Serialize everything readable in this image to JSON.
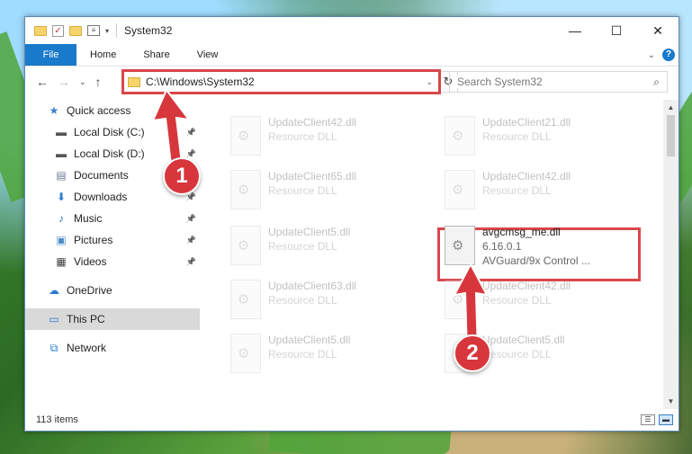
{
  "window": {
    "title": "System32",
    "controls": {
      "minimize": "—",
      "maximize": "☐",
      "close": "✕"
    }
  },
  "quick_access_toolbar": {
    "dropdown": "▾"
  },
  "ribbon": {
    "tabs": [
      "File",
      "Home",
      "Share",
      "View"
    ],
    "expand": "⌄",
    "help": "?"
  },
  "navigation": {
    "back": "←",
    "forward": "→",
    "recent": "⌄",
    "up": "↑"
  },
  "address": {
    "path": "C:\\Windows\\System32",
    "dropdown": "⌄",
    "refresh": "↻"
  },
  "search": {
    "placeholder": "Search System32",
    "icon": "⌕"
  },
  "nav_pane": {
    "items": [
      {
        "label": "Quick access",
        "icon": "star-icon",
        "glyph": "★",
        "color": "#3b7fd1",
        "level": 0,
        "pinned": false
      },
      {
        "label": "Local Disk (C:)",
        "icon": "drive-icon",
        "glyph": "▬",
        "color": "#555555",
        "level": 1,
        "pinned": true
      },
      {
        "label": "Local Disk (D:)",
        "icon": "drive-icon",
        "glyph": "▬",
        "color": "#555555",
        "level": 1,
        "pinned": true
      },
      {
        "label": "Documents",
        "icon": "documents-icon",
        "glyph": "▤",
        "color": "#6b7c93",
        "level": 1,
        "pinned": true
      },
      {
        "label": "Downloads",
        "icon": "download-icon",
        "glyph": "⬇",
        "color": "#2a7ad0",
        "level": 1,
        "pinned": true
      },
      {
        "label": "Music",
        "icon": "music-icon",
        "glyph": "♪",
        "color": "#2a7ad0",
        "level": 1,
        "pinned": true
      },
      {
        "label": "Pictures",
        "icon": "pictures-icon",
        "glyph": "▣",
        "color": "#4a8bc8",
        "level": 1,
        "pinned": true
      },
      {
        "label": "Videos",
        "icon": "videos-icon",
        "glyph": "▦",
        "color": "#444444",
        "level": 1,
        "pinned": true
      },
      {
        "label": "OneDrive",
        "icon": "cloud-icon",
        "glyph": "☁",
        "color": "#2a7ad0",
        "level": 0,
        "pinned": false
      },
      {
        "label": "This PC",
        "icon": "computer-icon",
        "glyph": "▭",
        "color": "#2a7ad0",
        "level": 0,
        "pinned": false
      },
      {
        "label": "Network",
        "icon": "network-icon",
        "glyph": "⧉",
        "color": "#2a7ad0",
        "level": 0,
        "pinned": false
      }
    ],
    "pin_glyph": "📌"
  },
  "files": [
    {
      "name": "UpdateClient42.dll",
      "sub": "Resource DLL",
      "faded": true
    },
    {
      "name": "UpdateClient21.dll",
      "sub": "Resource DLL",
      "faded": true
    },
    {
      "name": "UpdateClient65.dll",
      "sub": "Resource DLL",
      "faded": true
    },
    {
      "name": "UpdateClient42.dll",
      "sub": "Resource DLL",
      "faded": true
    },
    {
      "name": "UpdateClient5.dll",
      "sub": "Resource DLL",
      "faded": true
    },
    {
      "name": "avgcmsg_me.dll",
      "sub": "6.16.0.1",
      "sub2": "AVGuard/9x Control ...",
      "faded": false
    },
    {
      "name": "UpdateClient63.dll",
      "sub": "Resource DLL",
      "faded": true
    },
    {
      "name": "UpdateClient42.dll",
      "sub": "Resource DLL",
      "faded": true
    },
    {
      "name": "UpdateClient5.dll",
      "sub": "Resource DLL",
      "faded": true
    },
    {
      "name": "UpdateClient5.dll",
      "sub": "Resource DLL",
      "faded": true
    }
  ],
  "status": {
    "item_count": "113 items"
  },
  "annotations": {
    "step1": "1",
    "step2": "2",
    "highlight_color": "#d9474a"
  }
}
